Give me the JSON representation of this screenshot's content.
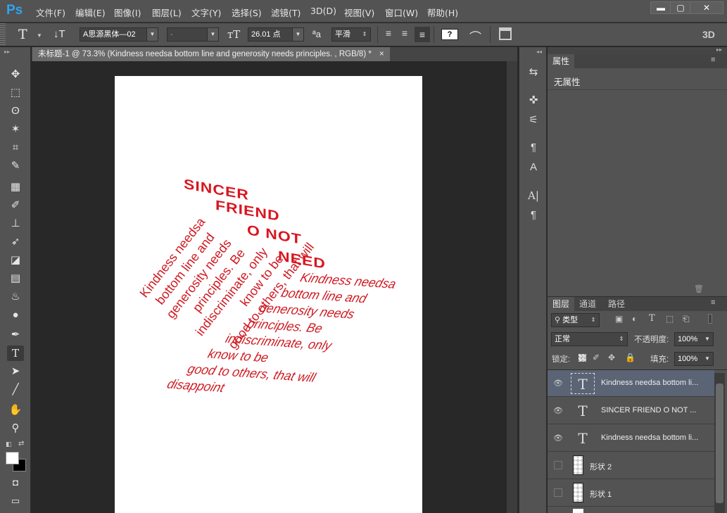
{
  "app": {
    "logo": "Ps"
  },
  "menu": [
    "文件(F)",
    "编辑(E)",
    "图像(I)",
    "图层(L)",
    "文字(Y)",
    "选择(S)",
    "滤镜(T)",
    "3D(D)",
    "视图(V)",
    "窗口(W)",
    "帮助(H)"
  ],
  "window_controls": {
    "minimize": "▬",
    "maximize": "▢",
    "close": "✕"
  },
  "options_bar": {
    "tool_glyph": "T",
    "font_family": "A思源黑体—02",
    "font_style": "-",
    "font_size": "26.01 点",
    "aa_label": "ªa",
    "anti_alias": "平滑",
    "color_swatch": "?",
    "three_d": "3D"
  },
  "document_tab": {
    "title": "未标题-1 @ 73.3% (Kindness needsa  bottom line and generosity needs  principles. , RGB/8) *",
    "close": "×"
  },
  "canvas": {
    "heading_lines": [
      "SINCER",
      "FRIEND",
      "O NOT",
      "NEED"
    ],
    "left_block": [
      "Kindness needsa",
      "bottom line and",
      "generosity needs",
      "principles. Be",
      "indiscriminate, only",
      "know to be",
      "good to others, that will"
    ],
    "right_block": [
      "Kindness needsa",
      "bottom line and",
      "generosity needs",
      "principles. Be",
      "indiscriminate, only",
      "know to be",
      "good to others, that will",
      "disappoint"
    ],
    "text_color": "#d9151f"
  },
  "properties_panel": {
    "tab": "属性",
    "content": "无属性"
  },
  "layers_panel": {
    "tabs": [
      "图层",
      "通道",
      "路径"
    ],
    "filter": "类型",
    "blend_mode": "正常",
    "opacity_label": "不透明度:",
    "opacity": "100%",
    "lock_label": "锁定:",
    "fill_label": "填充:",
    "fill": "100%",
    "layers": [
      {
        "name": "Kindness needsa  bottom li...",
        "type": "text",
        "visible": true,
        "selected": true
      },
      {
        "name": "SINCER  FRIEND  O NOT ...",
        "type": "text",
        "visible": true,
        "selected": false
      },
      {
        "name": "Kindness needsa  bottom li...",
        "type": "text",
        "visible": true,
        "selected": false
      },
      {
        "name": "形状 2",
        "type": "shape",
        "visible": false,
        "selected": false
      },
      {
        "name": "形状 1",
        "type": "shape",
        "visible": false,
        "selected": false
      }
    ]
  }
}
